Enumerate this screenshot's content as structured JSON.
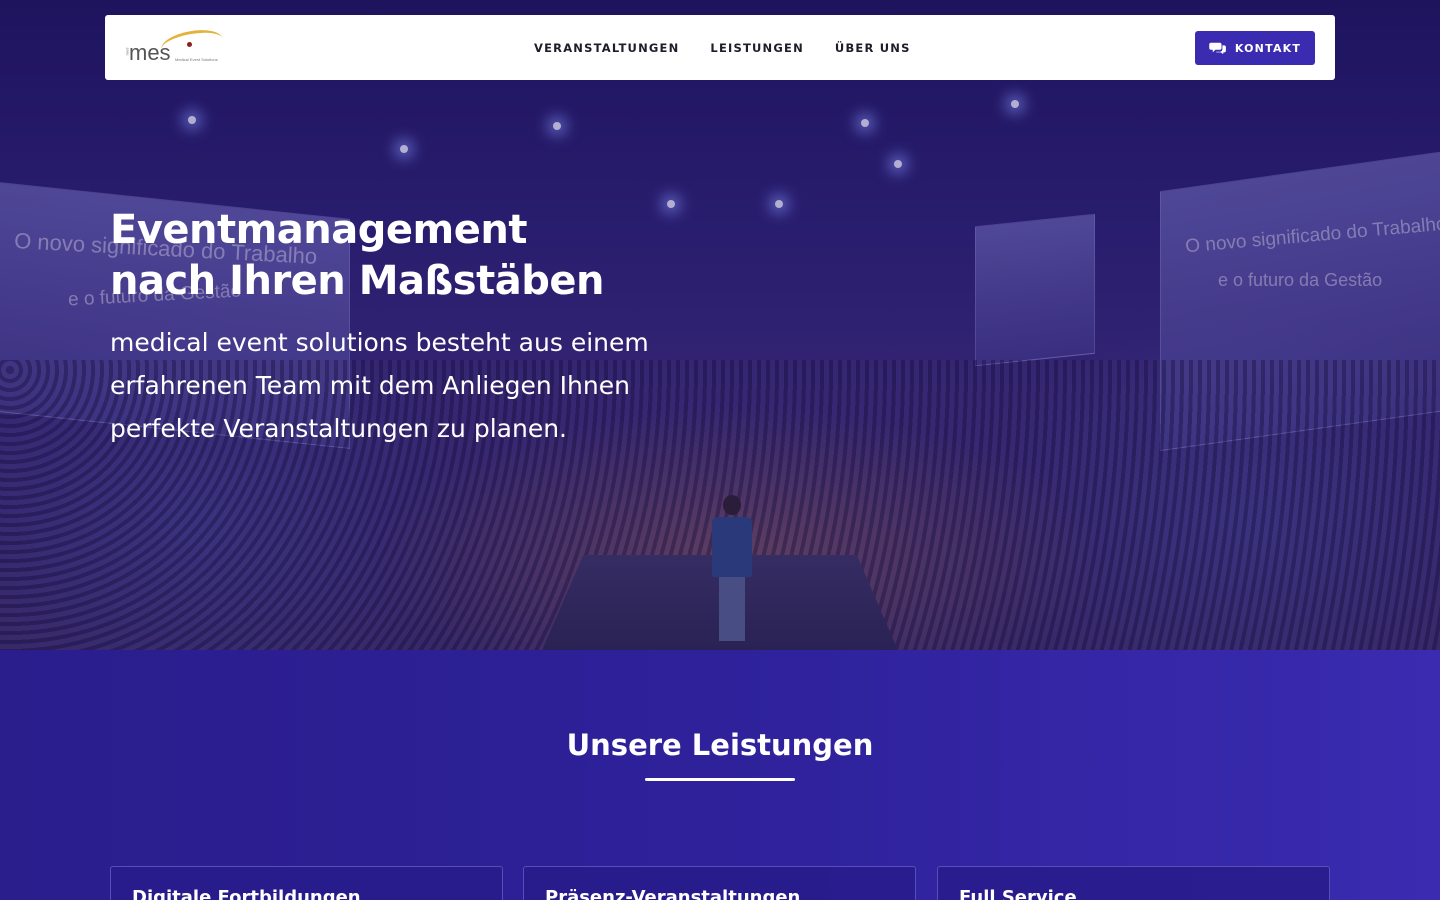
{
  "nav": {
    "logo_text": "mes",
    "logo_tagline": "Medical Event Solutions",
    "links": [
      "VERANSTALTUNGEN",
      "LEISTUNGEN",
      "ÜBER UNS"
    ],
    "contact_label": "KONTAKT"
  },
  "hero": {
    "title_line1": "Eventmanagement",
    "title_line2": "nach Ihren Maßstäben",
    "subtitle": "medical event solutions besteht aus einem erfahrenen Team mit dem Anliegen Ihnen perfekte Veranstaltungen zu planen.",
    "screen_text_1": "O novo significado do Trabalho",
    "screen_text_2": "e o futuro da Gestão"
  },
  "services": {
    "title": "Unsere Leistungen",
    "cards": [
      {
        "title": "Digitale Fortbildungen"
      },
      {
        "title": "Präsenz-Veranstaltungen"
      },
      {
        "title": "Full Service"
      }
    ]
  },
  "colors": {
    "accent": "#3b2bb0",
    "section_bg": "#2e219a",
    "nav_bg": "#ffffff"
  }
}
